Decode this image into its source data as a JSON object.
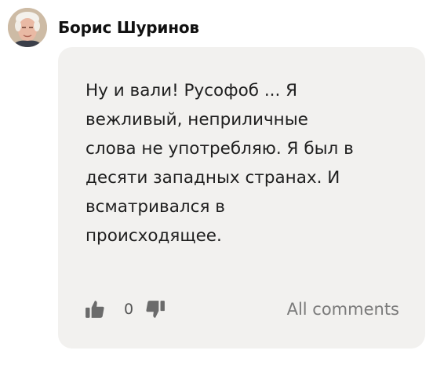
{
  "author": {
    "name": "Борис Шуринов",
    "avatar_icon": "user-avatar-photo"
  },
  "comment": {
    "text_lines": [
      "Ну и вали! Русофоб ... Я",
      "вежливый, неприличные",
      "слова не употребляю. Я был в",
      "десяти западных странах. И",
      "всматривался в",
      "происходящее."
    ]
  },
  "actions": {
    "like_icon": "thumbs-up-icon",
    "dislike_icon": "thumbs-down-icon",
    "rating": "0",
    "all_comments_label": "All comments"
  },
  "colors": {
    "bubble_bg": "#f2f1ef",
    "text": "#1f1f1f",
    "muted": "#7a7a7a",
    "icon": "#6b6b6b"
  }
}
